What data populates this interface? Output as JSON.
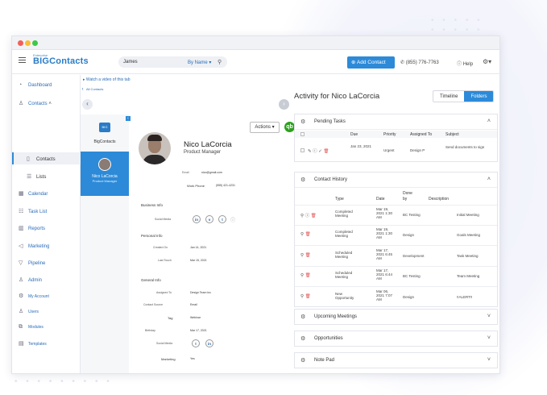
{
  "topbar": {
    "logo_small": "Enterprise",
    "logo": "BIGContacts",
    "search_query": "James",
    "search_by": "By Name",
    "add_contact": "Add Contact",
    "phone": "(855) 776-7763",
    "help": "Help"
  },
  "sidebar": {
    "items": [
      {
        "label": "Dashboard",
        "icon": "gauge-icon"
      },
      {
        "label": "Contacts",
        "icon": "user-icon"
      },
      {
        "label": "Contacts",
        "icon": "contact-card-icon"
      },
      {
        "label": "Lists",
        "icon": "list-icon"
      },
      {
        "label": "Calendar",
        "icon": "calendar-icon"
      },
      {
        "label": "Task List",
        "icon": "checklist-icon"
      },
      {
        "label": "Reports",
        "icon": "bar-chart-icon"
      },
      {
        "label": "Marketing",
        "icon": "megaphone-icon"
      },
      {
        "label": "Pipeline",
        "icon": "funnel-icon"
      },
      {
        "label": "Admin",
        "icon": "admin-icon"
      },
      {
        "label": "My Account",
        "icon": "gear-icon"
      },
      {
        "label": "Users",
        "icon": "users-icon"
      },
      {
        "label": "Modules",
        "icon": "modules-icon"
      },
      {
        "label": "Templates",
        "icon": "template-icon"
      }
    ]
  },
  "middle": {
    "watch_video": "Watch a video of this tab",
    "all_contacts": "All Contacts",
    "card_logo": "BIG",
    "card_label": "BigContacts",
    "selected_name": "Nico LaCorcia",
    "selected_role": "Product Manager"
  },
  "contact": {
    "name": "Nico LaCorcia",
    "role": "Product Manager",
    "actions": "Actions",
    "email_label": "Email",
    "email_value": "nico@gmail.com",
    "work_phone_label": "Work Phone",
    "work_phone_value": "(555) 421-4231",
    "business_info": "Business Info",
    "social_media": "Social Media",
    "personal_info": "Personal Info",
    "created_on_label": "Created On",
    "created_on_value": "Jan 14, 2021",
    "last_touch_label": "Last Touch",
    "last_touch_value": "Mar 15, 2021",
    "general_info": "General Info",
    "assigned_to_label": "Assigned To",
    "assigned_to_value": "Design Team Inc",
    "contact_source_label": "Contact Source",
    "contact_source_value": "Email",
    "tag_label": "Tag",
    "tag_value": "Webinar",
    "birthday_label": "Birthday",
    "birthday_value": "Mar 17, 2021",
    "social_media_label": "Social Media",
    "marketing_label": "Marketing",
    "marketing_value": "Yes"
  },
  "activity": {
    "title": "Activity for Nico LaCorcia",
    "timeline": "Timeline",
    "folders": "Folders",
    "pending": {
      "title": "Pending Tasks",
      "columns": [
        "Due",
        "Priority",
        "Assigned To",
        "Subject"
      ],
      "rows": [
        {
          "due": "Jan 23, 2021",
          "priority": "Urgent",
          "assigned": "Design P",
          "subject": "Send documents to sign"
        }
      ]
    },
    "history": {
      "title": "Contact History",
      "columns": [
        "Type",
        "Date",
        "Done by",
        "Description"
      ],
      "rows": [
        {
          "type": "Completed Meeting",
          "date": "Mar 19, 2021 1:30 AM",
          "by": "BC Testing",
          "desc": "Initial Meeting"
        },
        {
          "type": "Completed Meeting",
          "date": "Mar 19, 2021 1:30 AM",
          "by": "Design",
          "desc": "Goals Meeting"
        },
        {
          "type": "Scheduled Meeting",
          "date": "Mar 17, 2021 6:45 AM",
          "by": "Development",
          "desc": "Task Meeting"
        },
        {
          "type": "Scheduled Meeting",
          "date": "Mar 17, 2021 6:44 AM",
          "by": "BC Testing",
          "desc": "Team Meeting"
        },
        {
          "type": "New Opportunity",
          "date": "Mar 06, 2021 7:07 AM",
          "by": "Design",
          "desc": "!!ALERT!!"
        }
      ]
    },
    "upcoming": "Upcoming Meetings",
    "opportunities": "Opportunities",
    "notepad": "Note Pad"
  }
}
